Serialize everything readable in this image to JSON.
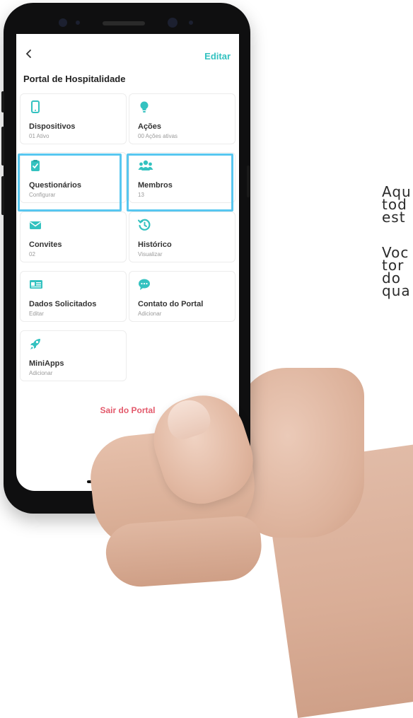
{
  "side_text": {
    "paragraph1": [
      "Aqu",
      "tod",
      "est"
    ],
    "paragraph2": [
      "Voc",
      "tor",
      "do",
      "qua"
    ]
  },
  "header": {
    "edit_label": "Editar",
    "title": "Portal de Hospitalidade"
  },
  "tiles": [
    {
      "title": "Dispositivos",
      "subtitle": "01 Ativo",
      "icon": "phone-icon"
    },
    {
      "title": "Ações",
      "subtitle": "00 Ações ativas",
      "icon": "lightbulb-icon"
    },
    {
      "title": "Questionários",
      "subtitle": "Configurar",
      "icon": "clipboard-check-icon"
    },
    {
      "title": "Membros",
      "subtitle": "13",
      "icon": "users-icon"
    },
    {
      "title": "Convites",
      "subtitle": "02",
      "icon": "envelope-icon"
    },
    {
      "title": "Histórico",
      "subtitle": "Visualizar",
      "icon": "history-icon"
    },
    {
      "title": "Dados Solicitados",
      "subtitle": "Editar",
      "icon": "id-card-icon"
    },
    {
      "title": "Contato do Portal",
      "subtitle": "Adicionar",
      "icon": "chat-bubble-icon"
    },
    {
      "title": "MiniApps",
      "subtitle": "Adicionar",
      "icon": "rocket-icon"
    }
  ],
  "logout_label": "Sair do Portal",
  "colors": {
    "accent": "#34c2c0",
    "highlight": "#58c7f0",
    "logout": "#e35a6c"
  }
}
